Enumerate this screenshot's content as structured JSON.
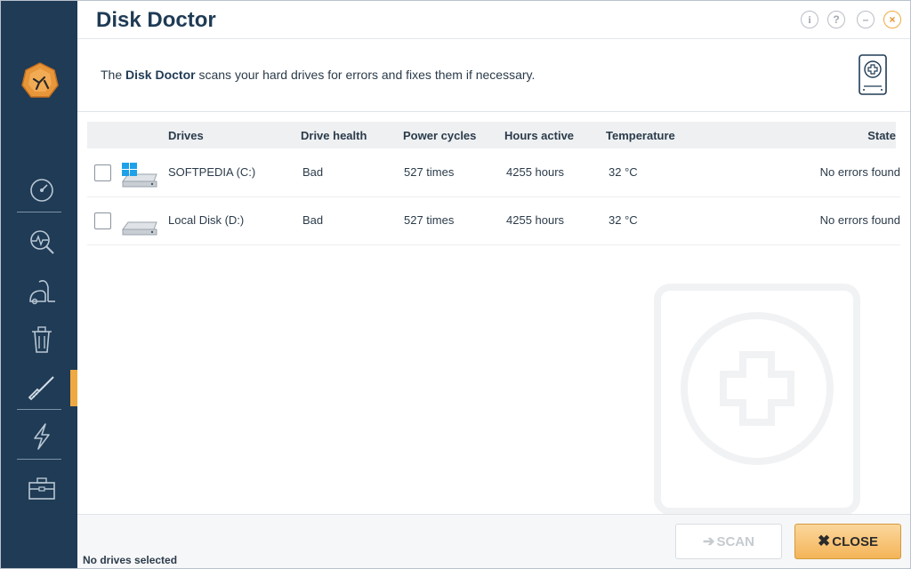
{
  "app": {
    "title": "Disk Doctor",
    "window_buttons": {
      "info": "i",
      "help": "?",
      "minimize": "–",
      "close": "×"
    }
  },
  "description": {
    "prefix": "The ",
    "bold": "Disk Doctor",
    "suffix": " scans your hard drives for errors and fixes them if necessary."
  },
  "sidebar": {
    "items": [
      {
        "name": "dashboard",
        "icon": "gauge-icon"
      },
      {
        "name": "analyze",
        "icon": "magnifier-pulse-icon"
      },
      {
        "name": "clean",
        "icon": "vacuum-icon"
      },
      {
        "name": "uninstall",
        "icon": "trash-icon"
      },
      {
        "name": "maintain",
        "icon": "screwdriver-icon",
        "active": true
      },
      {
        "name": "optimize",
        "icon": "lightning-icon"
      },
      {
        "name": "tools",
        "icon": "toolbox-icon"
      }
    ]
  },
  "table": {
    "columns": [
      "Drives",
      "Drive health",
      "Power cycles",
      "Hours active",
      "Temperature",
      "State"
    ],
    "rows": [
      {
        "drive": "SOFTPEDIA (C:)",
        "health": "Bad",
        "cycles": "527 times",
        "hours": "4255 hours",
        "temp": "32 °C",
        "state": "No errors found",
        "icon": "system-drive-icon"
      },
      {
        "drive": "Local Disk (D:)",
        "health": "Bad",
        "cycles": "527 times",
        "hours": "4255 hours",
        "temp": "32 °C",
        "state": "No errors found",
        "icon": "drive-icon"
      }
    ]
  },
  "footer": {
    "status": "No drives selected",
    "scan_label": "SCAN",
    "close_label": "CLOSE"
  },
  "colors": {
    "sidebar": "#1f3b55",
    "accent": "#f0a941"
  }
}
